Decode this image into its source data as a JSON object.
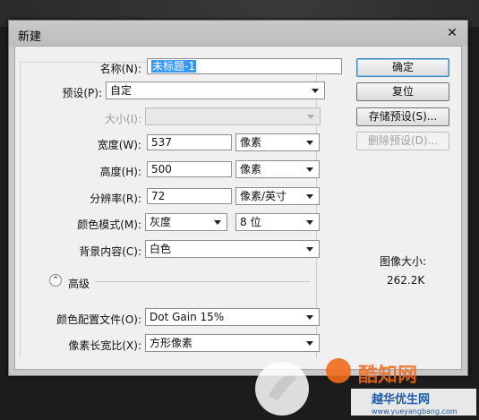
{
  "dialog": {
    "title": "新建",
    "close_glyph": "✕"
  },
  "fields": {
    "name": {
      "label": "名称(N):",
      "value": "未标题-1"
    },
    "preset": {
      "label": "预设(P):",
      "value": "自定"
    },
    "size": {
      "label": "大小(I):",
      "value": ""
    },
    "width": {
      "label": "宽度(W):",
      "value": "537",
      "unit": "像素"
    },
    "height": {
      "label": "高度(H):",
      "value": "500",
      "unit": "像素"
    },
    "resolution": {
      "label": "分辨率(R):",
      "value": "72",
      "unit": "像素/英寸"
    },
    "color_mode": {
      "label": "颜色模式(M):",
      "value": "灰度",
      "depth": "8 位"
    },
    "background": {
      "label": "背景内容(C):",
      "value": "白色"
    },
    "advanced": {
      "label": "高级"
    },
    "color_profile": {
      "label": "颜色配置文件(O):",
      "value": "Dot Gain 15%"
    },
    "pixel_aspect": {
      "label": "像素长宽比(X):",
      "value": "方形像素"
    }
  },
  "buttons": {
    "ok": "确定",
    "reset": "复位",
    "save_preset": "存储预设(S)...",
    "delete_preset": "删除预设(D)..."
  },
  "image_size": {
    "label": "图像大小:",
    "value": "262.2K"
  },
  "watermark": {
    "text1": "酷知网",
    "text2": "越华优生网",
    "url": "www.yueyangbang.com"
  },
  "colors": {
    "accent": "#3399ff",
    "watermark": "#f06a1a"
  }
}
